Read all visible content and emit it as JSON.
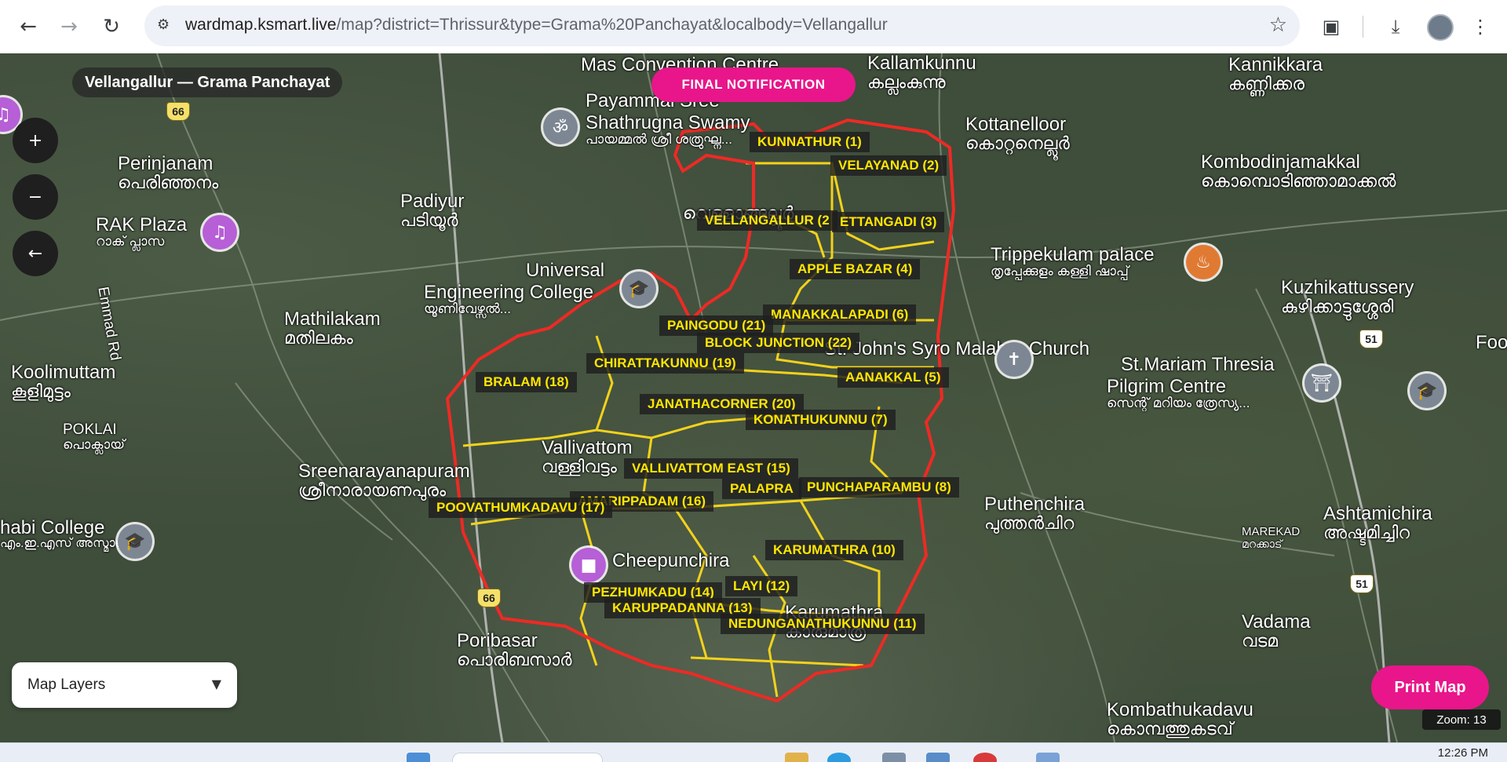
{
  "browser": {
    "url_host": "wardmap.ksmart.live",
    "url_path": "/map?district=Thrissur&type=Grama%20Panchayat&localbody=Vellangallur",
    "back_icon": "back-arrow-icon",
    "forward_icon": "forward-arrow-icon",
    "reload_icon": "reload-icon",
    "bookmark_icon": "star-icon",
    "right_icons": [
      "search-tab-icon",
      "download-icon",
      "profile-avatar",
      "menu-dots-icon"
    ]
  },
  "header": {
    "title": "Vellangallur — Grama Panchayat",
    "notification": "FINAL NOTIFICATION"
  },
  "map_controls": {
    "zoom_in": "+",
    "zoom_out": "−",
    "back": "←"
  },
  "layers": {
    "label": "Map Layers",
    "arrow": "▼"
  },
  "print_button": "Print Map",
  "zoom_label": "Zoom: 13",
  "wards": [
    {
      "name": "KUNNATHUR (1)"
    },
    {
      "name": "VELAYANAD (2)"
    },
    {
      "name": "VELLANGALLUR (2"
    },
    {
      "name": "ETTANGADI (3)"
    },
    {
      "name": "APPLE BAZAR (4)"
    },
    {
      "name": "MANAKKALAPADI (6)"
    },
    {
      "name": "PAINGODU (21)"
    },
    {
      "name": "BLOCK JUNCTION (22)"
    },
    {
      "name": "CHIRATTAKUNNU (19)"
    },
    {
      "name": "AANAKKAL (5)"
    },
    {
      "name": "BRALAM (18)"
    },
    {
      "name": "JANATHACORNER (20)"
    },
    {
      "name": "KONATHUKUNNU (7)"
    },
    {
      "name": "VALLIVATTOM EAST (15)"
    },
    {
      "name": "PUNCHAPARAMBU (8)"
    },
    {
      "name": "PALAPRA"
    },
    {
      "name": "AMARIPPADAM (16)"
    },
    {
      "name": "POOVATHUMKADAVU (17)"
    },
    {
      "name": "KARUMATHRA (10)"
    },
    {
      "name": "LAYI (12)"
    },
    {
      "name": "PEZHUMKADU (14)"
    },
    {
      "name": "KARUPPADANNA (13)"
    },
    {
      "name": "NEDUNGANATHUKUNNU (11)"
    }
  ],
  "places": [
    {
      "en": "Mas Convention Centre",
      "ml": ""
    },
    {
      "en": "Kallamkunnu",
      "ml": "കല്ലംകുന്നു"
    },
    {
      "en": "Kannikkara",
      "ml": "കണ്ണിക്കര"
    },
    {
      "en": "Payammal Sree",
      "ml": ""
    },
    {
      "en": "Shathrugna Swamy",
      "ml": "പായമ്മൽ ശ്രീ ശത്രുഘ്ന..."
    },
    {
      "en": "Kottanelloor",
      "ml": "കൊറ്റനെല്ലൂർ"
    },
    {
      "en": "Kombodinjamakkal",
      "ml": "കൊമ്പൊടിഞ്ഞാമാക്കൽ"
    },
    {
      "en": "Perinjanam",
      "ml": "പെരിഞ്ഞനം"
    },
    {
      "en": "Padiyur",
      "ml": "പടിയൂർ"
    },
    {
      "en": "RAK Plaza",
      "ml": "റാക് പ്ലാസ"
    },
    {
      "en": "Emmad Rd",
      "ml": ""
    },
    {
      "en": "Vellangallur",
      "ml": "വെള്ളാങ്ങല്ലൂർ"
    },
    {
      "en": "Trippekulam palace",
      "ml": "തൃപ്പേക്കുളം കള്ളി ഷാപ്പ്"
    },
    {
      "en": "Universal",
      "ml": ""
    },
    {
      "en": "Engineering College",
      "ml": "യൂണിവേഴ്സൽ..."
    },
    {
      "en": "Mathilakam",
      "ml": "മതിലകം"
    },
    {
      "en": "Kuzhikattussery",
      "ml": "കുഴിക്കാട്ടുശ്ശേരി"
    },
    {
      "en": "Koolimuttam",
      "ml": "കൂളിമുട്ടം"
    },
    {
      "en": "POKLAI",
      "ml": "പൊക്ലായ്"
    },
    {
      "en": "St. John's Syro Malabar Church",
      "ml": ""
    },
    {
      "en": "St.Mariam Thresia",
      "ml": ""
    },
    {
      "en": "Pilgrim Centre",
      "ml": "സെന്റ് മറിയം ത്രേസ്യ..."
    },
    {
      "en": "Food",
      "ml": ""
    },
    {
      "en": "Vallivattom",
      "ml": "വള്ളിവട്ടം"
    },
    {
      "en": "Sreenarayanapuram",
      "ml": "ശ്രീനാരായണപുരം"
    },
    {
      "en": "Puthenchira",
      "ml": "പുത്തൻചിറ"
    },
    {
      "en": "Ashtamichira",
      "ml": "അഷ്ടമിച്ചിറ"
    },
    {
      "en": "habi College",
      "ml": "എം.ഇ.എസ് അസ്മാബി..."
    },
    {
      "en": "Cheepunchira",
      "ml": ""
    },
    {
      "en": "MAREKAD",
      "ml": "മറക്കാട്"
    },
    {
      "en": "Karumathra",
      "ml": "കാരുമാത്ര"
    },
    {
      "en": "Poribasar",
      "ml": "പൊരിബസാർ"
    },
    {
      "en": "Vadama",
      "ml": "വടമ"
    },
    {
      "en": "Kombathukadavu",
      "ml": "കൊമ്പത്തുകടവ്"
    }
  ],
  "highways": [
    "66",
    "66",
    "51",
    "51"
  ],
  "taskbar": {
    "clock": "12:26 PM"
  }
}
